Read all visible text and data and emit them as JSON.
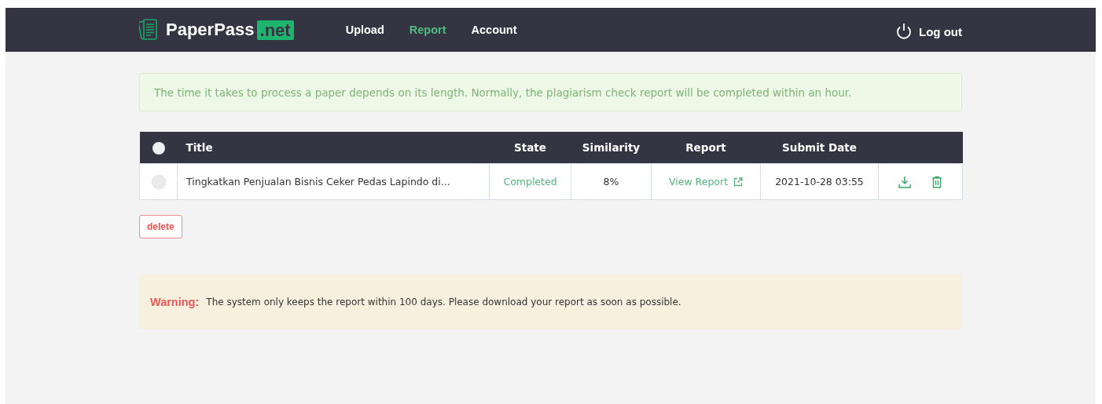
{
  "header": {
    "logo": {
      "name": "PaperPass",
      "suffix": ".net"
    },
    "nav": [
      {
        "label": "Upload",
        "selected": false
      },
      {
        "label": "Report",
        "selected": true
      },
      {
        "label": "Account",
        "selected": false
      }
    ],
    "logout": "Log out"
  },
  "notice": "The time it takes to process a paper depends on its length. Normally, the plagiarism check report will be completed within an hour.",
  "table": {
    "select_all": {
      "checked": false
    },
    "columns": [
      "Title",
      "State",
      "Similarity",
      "Report",
      "Submit Date"
    ],
    "rows": [
      {
        "checked": false,
        "title": "Tingkatkan Penjualan Bisnis Ceker Pedas Lapindo di...",
        "state": "Completed",
        "similarity": "8%",
        "report": "View Report",
        "submit_date": "2021-10-28 03:55"
      }
    ]
  },
  "delete_button": "delete",
  "warning": {
    "label": "Warning:",
    "message": "The system only keeps the report within 100 days. Please download your report as soon as possible."
  }
}
